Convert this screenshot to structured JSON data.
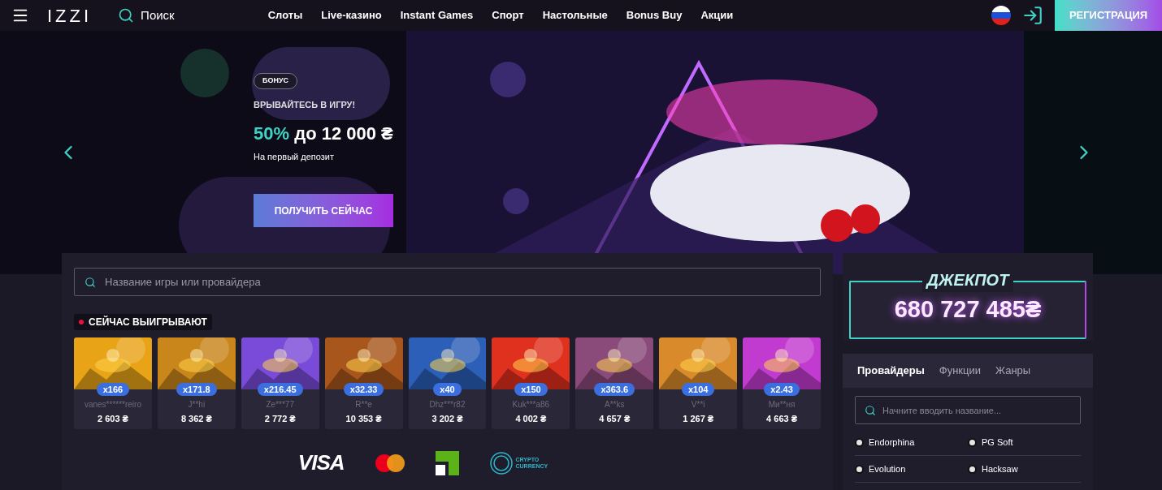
{
  "header": {
    "logo": "IZZI",
    "search_label": "Поиск",
    "nav": [
      "Слоты",
      "Live-казино",
      "Instant Games",
      "Спорт",
      "Настольные",
      "Bonus Buy",
      "Акции"
    ],
    "register": "РЕГИСТРАЦИЯ"
  },
  "banner": {
    "tag": "БОНУС",
    "kicker": "ВРЫВАЙТЕСЬ В ИГРУ!",
    "highlight": "50%",
    "headline": "до 12 000 ₴",
    "subtitle": "На первый депозит",
    "cta": "ПОЛУЧИТЬ СЕЙЧАС"
  },
  "games_search": {
    "placeholder": "Название игры или провайдера"
  },
  "winners": {
    "title": "СЕЙЧАС ВЫИГРЫВАЮТ",
    "items": [
      {
        "multiplier": "x166",
        "user": "vanes******reiro",
        "amount": "2 603 ₴",
        "color": "#e8a317"
      },
      {
        "multiplier": "x171.8",
        "user": "J**hi",
        "amount": "8 362 ₴",
        "color": "#c9861a"
      },
      {
        "multiplier": "x216.45",
        "user": "Ze***77",
        "amount": "2 772 ₴",
        "color": "#7a4bd8"
      },
      {
        "multiplier": "x32.33",
        "user": "R**e",
        "amount": "10 353 ₴",
        "color": "#a8561c"
      },
      {
        "multiplier": "x40",
        "user": "Dhz***r82",
        "amount": "3 202 ₴",
        "color": "#2c5fb8"
      },
      {
        "multiplier": "x150",
        "user": "Kuk***a86",
        "amount": "4 002 ₴",
        "color": "#e0301e"
      },
      {
        "multiplier": "x363.6",
        "user": "A**ks",
        "amount": "4 657 ₴",
        "color": "#8a4a7a"
      },
      {
        "multiplier": "x104",
        "user": "V**i",
        "amount": "1 267 ₴",
        "color": "#d98a2a"
      },
      {
        "multiplier": "x2.43",
        "user": "Ми**ня",
        "amount": "4 663 ₴",
        "color": "#c23bd0"
      }
    ]
  },
  "payments": {
    "visa": "VISA",
    "crypto": [
      "CRYPTO",
      "CURRENCY"
    ]
  },
  "jackpot": {
    "title": "ДЖЕКПОТ",
    "amount": "680 727 485₴"
  },
  "providers": {
    "tabs": [
      {
        "label": "Провайдеры",
        "selected": true
      },
      {
        "label": "Функции",
        "selected": false
      },
      {
        "label": "Жанры",
        "selected": false
      }
    ],
    "search": {
      "placeholder": "Начните вводить название..."
    },
    "items": [
      "Endorphina",
      "PG Soft",
      "Evolution",
      "Hacksaw"
    ]
  }
}
